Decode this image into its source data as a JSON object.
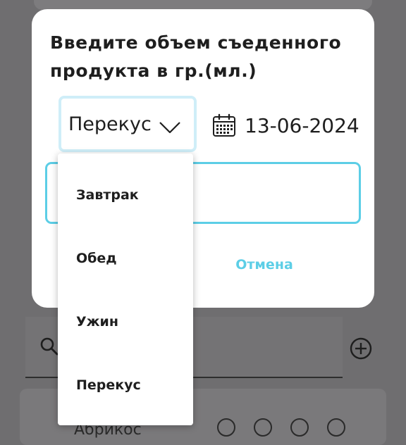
{
  "dialog": {
    "title": "Введите объем съеденного продукта в гр.(мл.)",
    "meal_type_selected": "Перекус",
    "date": "13-06-2024",
    "amount_value": "",
    "cancel_label": "Отмена"
  },
  "dropdown": {
    "options": [
      "Завтрак",
      "Обед",
      "Ужин",
      "Перекус"
    ]
  },
  "background": {
    "item_name": "Абрикос"
  },
  "colors": {
    "accent": "#5ccee6",
    "select_border": "#cfeef8",
    "overlay": "#6f6e70"
  },
  "icons": [
    "chevron-down-icon",
    "calendar-icon",
    "search-icon",
    "add-circle-icon",
    "edit-icon",
    "heart-icon",
    "info-icon",
    "filter-icon"
  ]
}
